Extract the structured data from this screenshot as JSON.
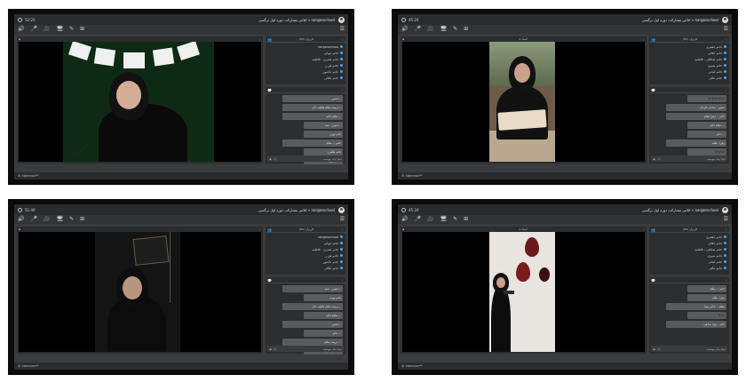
{
  "app": {
    "title": "کلاس مشارکت دوره اول نرگسی « nargesschool",
    "tools": [
      "🔊",
      "🎤",
      "🎥",
      "🖥",
      "✎",
      "⊞"
    ],
    "menu_icon": "☰",
    "status_text": "Narnean**",
    "chat_placeholder": "اینجا پیام بنویسید"
  },
  "screens": [
    {
      "clock": "52:25",
      "video_head": "",
      "users_title": "کاربران (55)",
      "users": [
        "nargesschool",
        "خانم جوانی",
        "خانم صدری - فاطمه",
        "خانم ش ر",
        "خانم عاشور",
        "خانم جلالی"
      ],
      "messages": [
        "حسین...",
        "درسته سلام فاطمه جان...",
        "سلام خانم ...",
        "حسین - شید...",
        "خانم نوری",
        "خانم ... سلام",
        "خانم طاهری",
        "شام اول..."
      ]
    },
    {
      "clock": "45:24",
      "video_head": "استاد 4",
      "users_title": "کاربران (55)",
      "users": [
        "خانم جعفری",
        "خانم جلالی",
        "خانم صادقی - فاطمه",
        "خانم شیری",
        "خانم امانی",
        "خانم عالی"
      ],
      "messages": [
        "🖤🖤🖤🖤🖤",
        "حسین - صاحب الزمان",
        "خانم ... زهرا سلام",
        "سلام خانم ...",
        "خانم ...",
        "زهرا - طلبه",
        "🖤🖤🖤"
      ]
    },
    {
      "clock": "51:40",
      "video_head": "",
      "users_title": "کاربران (55)",
      "users": [
        "nargesschool",
        "خانم جوانی",
        "خانم صدری - فاطمه",
        "خانم ش ر",
        "خانم عاشور",
        "خانم جلالی"
      ],
      "messages": [
        "حسین - شید...",
        "خانم نوری",
        "درسته سلام فاطمه جان...",
        "سلام خانم ...",
        "حسین...",
        "خانم ...",
        "درسته سلام ...",
        "سلام خانم ..."
      ]
    },
    {
      "clock": "45:24",
      "video_head": "استاد 4",
      "users_title": "کاربران (55)",
      "users": [
        "خانم جعفری",
        "خانم جلالی",
        "خانم صادقی - فاطمه",
        "خانم شیری",
        "خانم امانی",
        "خانم عالی"
      ],
      "messages": [
        "خانم ... سلام",
        "زهرا - طلبه",
        "سلام ... خانم زهرا",
        "🖤🖤",
        "خانم - زهرا صادقی"
      ]
    }
  ],
  "colors": {
    "accent": "#4aa3ff",
    "panel": "#2c2d2f",
    "frame": "#0b0b0b"
  }
}
